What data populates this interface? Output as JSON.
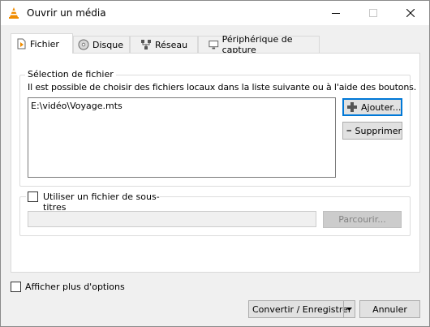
{
  "window": {
    "title": "Ouvrir un média"
  },
  "tabs": [
    {
      "label": "Fichier",
      "icon": "file-icon"
    },
    {
      "label": "Disque",
      "icon": "disc-icon"
    },
    {
      "label": "Réseau",
      "icon": "network-icon"
    },
    {
      "label": "Périphérique de capture",
      "icon": "capture-device-icon"
    }
  ],
  "file_selection": {
    "legend": "Sélection de fichier",
    "description": "Il est possible de choisir des fichiers locaux dans la liste suivante ou à l'aide des boutons.",
    "files": [
      "E:\\vidéo\\Voyage.mts"
    ],
    "add_label": "Ajouter...",
    "remove_label": "Supprimer"
  },
  "subtitles": {
    "checkbox_label": "Utiliser un fichier de sous-titres",
    "checked": false,
    "path_value": "",
    "browse_label": "Parcourir..."
  },
  "footer": {
    "more_options_label": "Afficher plus d'options",
    "more_options_checked": false,
    "convert_label": "Convertir / Enregistrer",
    "cancel_label": "Annuler"
  },
  "colors": {
    "accent": "#0078d7",
    "vlc_orange": "#f08c00"
  }
}
